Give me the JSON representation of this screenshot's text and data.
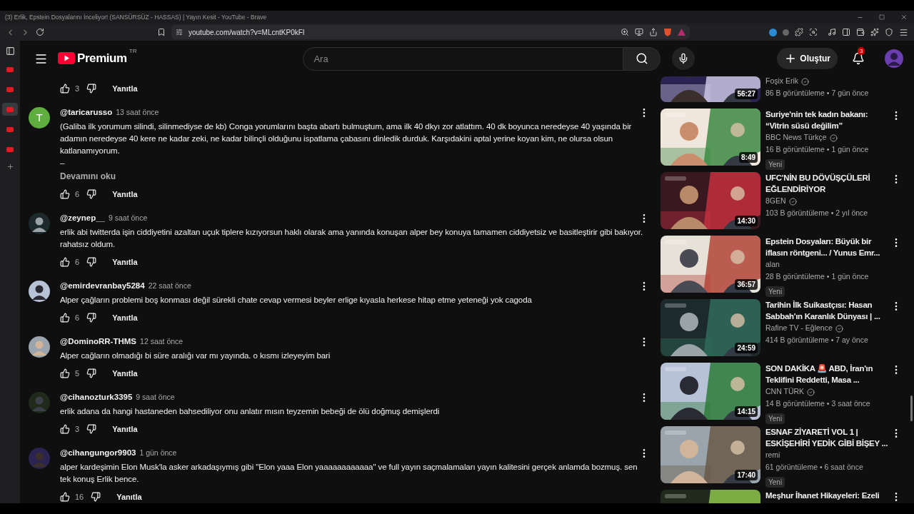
{
  "browser": {
    "title": "(3) Erlik, Epstein Dosyalarını İnceliyor! (SANSÜRSÜZ - HASSAS) | Yayın Kesit - YouTube - Brave",
    "url": "youtube.com/watch?v=MLcntKP0kFI"
  },
  "browser_sidebar": {
    "tabs": [
      {
        "selected": false
      },
      {
        "selected": false
      },
      {
        "selected": true
      },
      {
        "selected": false
      },
      {
        "selected": false
      }
    ]
  },
  "header": {
    "logo": "Premium",
    "region": "TR",
    "search": {
      "placeholder": "Ara"
    },
    "create_button": "Oluştur",
    "notifications": "3"
  },
  "top_actions": {
    "likes": "3",
    "reply": "Yanıtla"
  },
  "comments": [
    {
      "user": "@taricarusso",
      "time": "13 saat önce",
      "avatar": {
        "kind": "letter",
        "letter": "T",
        "color": "#5fad3f"
      },
      "text": "(Galiba ilk yorumum silindi, silinmediyse de kb) Conga yorumlarını başta abartı bulmuştum, ama ilk 40 dkyı zor atlattım. 40 dk boyunca neredeyse 40 yaşında bir adamın neredeyse 40 kere ne kadar zeki, ne kadar bilinçli olduğunu ispatlama çabasını dinledik durduk. Karşıdakini aptal yerine koyan kim, ne olursa olsun katlanamıyorum.\n–",
      "read_more": "Devamını oku",
      "likes": "6",
      "reply": "Yanıtla"
    },
    {
      "user": "@zeynep__",
      "time": "9 saat önce",
      "text": "erlik abi twitterda işin ciddiyetini azaltan uçuk tiplere kızıyorsun haklı olarak ama yanında konuşan alper bey konuya tamamen ciddiyetsiz ve basitleştirir gibi bakıyor. rahatsız oldum.",
      "likes": "6",
      "reply": "Yanıtla"
    },
    {
      "user": "@emirdevranbay5284",
      "time": "22 saat önce",
      "text": "Alper çağların problemi boş konması değil sürekli chate cevap vermesi beyler erlige kıyasla herkese hitap etme yeteneği yok cagoda",
      "likes": "6",
      "reply": "Yanıtla"
    },
    {
      "user": "@DominoRR-THMS",
      "time": "12 saat önce",
      "text": "Alper cağların olmadığı bi süre aralığı var mı yayında. o kısmı izleyeyim bari",
      "likes": "5",
      "reply": "Yanıtla"
    },
    {
      "user": "@cihanozturk3395",
      "time": "9 saat önce",
      "text": "erlik adana da hangi hastaneden bahsediliyor onu anlatır mısın teyzemin bebeği de ölü doğmuş demişlerdi",
      "likes": "3",
      "reply": "Yanıtla"
    },
    {
      "user": "@cihangungor9903",
      "time": "1 gün önce",
      "text": "alper kardeşimin Elon Musk'la asker arkadaşıymış gibi \"Elon yaaa Elon yaaaaaaaaaaaa\" ve full yayın saçmalamaları yayın kalitesini gerçek anlamda bozmuş. sen tek konuş Erlik bence.",
      "likes": "16",
      "reply": "Yanıtla"
    }
  ],
  "videos": [
    {
      "channel": "Foşix Erik",
      "verified": true,
      "meta": "86 B görüntüleme • 7 gün önce",
      "duration": "56:27"
    },
    {
      "title": "Suriye'nin tek kadın bakanı: “Vitrin süsü değilim”",
      "channel": "BBC News Türkçe",
      "verified": true,
      "meta": "16 B görüntüleme • 1 gün önce",
      "duration": "8:49",
      "new_badge": "Yeni"
    },
    {
      "title": "UFC'NİN BU DÖVÜŞÇÜLERİ EĞLENDİRİYOR",
      "channel": "8GEN",
      "verified": true,
      "meta": "103 B görüntüleme • 2 yıl önce",
      "duration": "14:30"
    },
    {
      "title": "Epstein Dosyaları: Büyük bir iflasın röntgeni... / Yunus Emr...",
      "channel": "alan",
      "verified": false,
      "meta": "28 B görüntüleme • 1 gün önce",
      "duration": "36:57",
      "new_badge": "Yeni"
    },
    {
      "title": "Tarihin İlk Suikastçısı: Hasan Sabbah'ın Karanlık Dünyası | ...",
      "channel": "Rafine TV - Eğlence",
      "verified": true,
      "meta": "414 B görüntüleme • 7 ay önce",
      "duration": "24:59"
    },
    {
      "title": "SON DAKİKA 🚨 ABD, İran'ın Teklifini Reddetti, Masa ...",
      "channel": "CNN TÜRK",
      "verified": true,
      "meta": "14 B görüntüleme • 3 saat önce",
      "duration": "14:15",
      "new_badge": "Yeni"
    },
    {
      "title": "ESNAF ZİYARETİ VOL 1 | ESKİŞEHİRİ YEDİK GİBİ BİŞEY ...",
      "channel": "remi",
      "verified": false,
      "meta": "61 görüntüleme • 6 saat önce",
      "duration": "17:40",
      "new_badge": "Yeni"
    },
    {
      "title": "Meşhur İhanet Hikayeleri:  Ezeli"
    }
  ]
}
